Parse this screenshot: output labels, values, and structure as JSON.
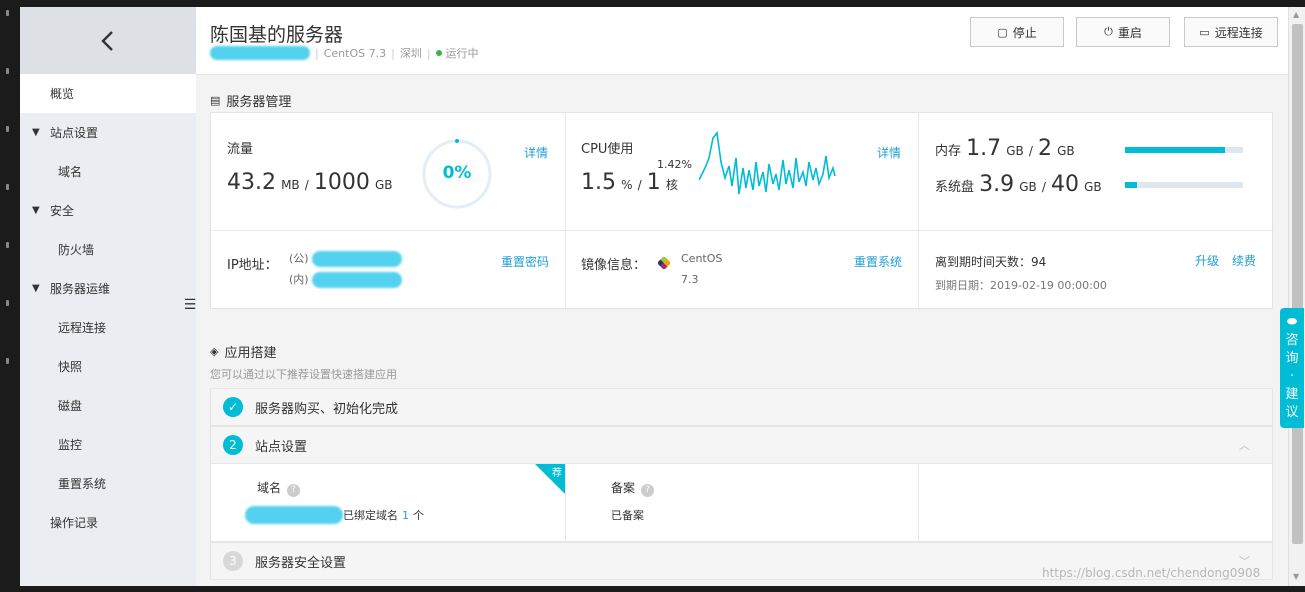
{
  "sidebar": {
    "items": [
      {
        "label": "概览"
      },
      {
        "label": "站点设置"
      },
      {
        "label": "域名"
      },
      {
        "label": "安全"
      },
      {
        "label": "防火墙"
      },
      {
        "label": "服务器运维"
      },
      {
        "label": "远程连接"
      },
      {
        "label": "快照"
      },
      {
        "label": "磁盘"
      },
      {
        "label": "监控"
      },
      {
        "label": "重置系统"
      },
      {
        "label": "操作记录"
      }
    ]
  },
  "header": {
    "title": "陈国基的服务器",
    "os": "CentOS 7.3",
    "region": "深圳",
    "status": "运行中",
    "buttons": {
      "stop": "停止",
      "restart": "重启",
      "remote": "远程连接"
    }
  },
  "server_mgmt": {
    "title": "服务器管理",
    "traffic": {
      "label": "流量",
      "used": "43.2",
      "used_unit": "MB",
      "total": "1000",
      "total_unit": "GB",
      "percent_text": "0%",
      "detail": "详情"
    },
    "cpu": {
      "label": "CPU使用",
      "peak": "1.42%",
      "value": "1.5",
      "value_unit": "%",
      "cores": "1",
      "cores_unit": "核",
      "detail": "详情"
    },
    "memory": {
      "label": "内存",
      "used": "1.7",
      "used_unit": "GB",
      "total": "2",
      "total_unit": "GB",
      "fill": 0.85
    },
    "disk": {
      "label": "系统盘",
      "used": "3.9",
      "used_unit": "GB",
      "total": "40",
      "total_unit": "GB",
      "fill": 0.1
    },
    "ip": {
      "label": "IP地址：",
      "public_prefix": "(公)",
      "private_prefix": "(内)",
      "reset_password": "重置密码"
    },
    "image": {
      "label": "镜像信息：",
      "name": "CentOS",
      "version": "7.3",
      "reset_system": "重置系统"
    },
    "expiry": {
      "days_text": "离到期时间天数：94",
      "date_text": "到期日期：2019-02-19 00:00:00",
      "upgrade": "升级",
      "renew": "续费"
    }
  },
  "app_setup": {
    "title": "应用搭建",
    "hint": "您可以通过以下推荐设置快速搭建应用",
    "steps": [
      {
        "num": "✓",
        "label": "服务器购买、初始化完成"
      },
      {
        "num": "2",
        "label": "站点设置"
      },
      {
        "num": "3",
        "label": "服务器安全设置"
      }
    ],
    "domain": {
      "label": "域名",
      "bound_text": "已绑定域名",
      "bound_count": "1",
      "count_unit": "个",
      "tag": "荐"
    },
    "filing": {
      "label": "备案",
      "status": "已备案"
    }
  },
  "consult": {
    "chars": [
      "咨",
      "询",
      "·",
      "建",
      "议"
    ]
  },
  "watermark": "https://blog.csdn.net/chendong0908",
  "colors": {
    "accent": "#00bcd4",
    "link": "#1e9fd6",
    "status_green": "#3ab54a"
  }
}
